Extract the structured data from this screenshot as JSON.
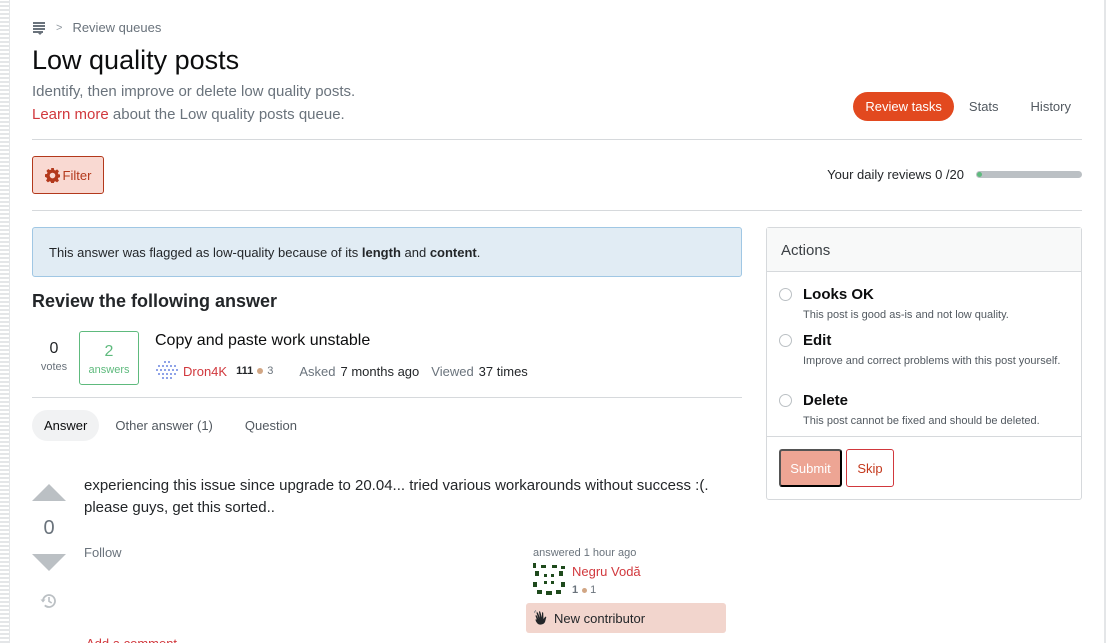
{
  "breadcrumb": {
    "icon": "stack-exchange-icon",
    "separator": ">",
    "label": "Review queues"
  },
  "header": {
    "title": "Low quality posts",
    "subtitle": "Identify, then improve or delete low quality posts.",
    "learn_more_link": "Learn more",
    "learn_more_rest": " about the Low quality posts queue."
  },
  "nav_tabs": [
    {
      "label": "Review tasks",
      "active": true
    },
    {
      "label": "Stats",
      "active": false
    },
    {
      "label": "History",
      "active": false
    }
  ],
  "filter": {
    "label": "Filter",
    "icon": "gear-icon"
  },
  "daily_reviews": {
    "label": "Your daily reviews",
    "done": 0,
    "limit": 20,
    "text": "0 /20",
    "progress_fraction": 0.0
  },
  "notice": {
    "prefix": "This answer was flagged as low-quality because of its ",
    "reason1": "length",
    "middle": " and ",
    "reason2": "content",
    "suffix": "."
  },
  "review_heading": "Review the following answer",
  "question": {
    "votes": "0",
    "votes_label": "votes",
    "answers": "2",
    "answers_label": "answers",
    "title": "Copy and paste work unstable",
    "author": "Dron4K",
    "author_rep": "111",
    "author_bronze": "3",
    "asked_label": "Asked",
    "asked_value": "7 months ago",
    "viewed_label": "Viewed",
    "viewed_value": "37 times"
  },
  "post_tabs": [
    {
      "label": "Answer",
      "active": true
    },
    {
      "label": "Other answer (1)",
      "active": false
    },
    {
      "label": "Question",
      "active": false
    }
  ],
  "answer": {
    "score": "0",
    "body": "experiencing this issue since upgrade to 20.04... tried various workarounds without success :(. please guys, get this sorted..",
    "follow_label": "Follow",
    "add_comment_label": "Add a comment",
    "answered_label": "answered 1 hour ago",
    "author": "Negru Vodă",
    "author_rep": "1",
    "author_bronze": "1",
    "new_contributor_label": "New contributor"
  },
  "actions": {
    "title": "Actions",
    "options": [
      {
        "title": "Looks OK",
        "desc": "This post is good as-is and not low quality.",
        "checked": false
      },
      {
        "title": "Edit",
        "desc": "Improve and correct problems with this post yourself.",
        "checked": false
      },
      {
        "title": "Delete",
        "desc": "This post cannot be fixed and should be deleted.",
        "checked": false
      }
    ],
    "submit_label": "Submit",
    "skip_label": "Skip"
  },
  "colors": {
    "accent": "#e2491f",
    "link": "#d1383d",
    "success": "#5eba7d",
    "notice_bg": "#e1ecf4",
    "new_contributor_bg": "#f2d5cd"
  }
}
